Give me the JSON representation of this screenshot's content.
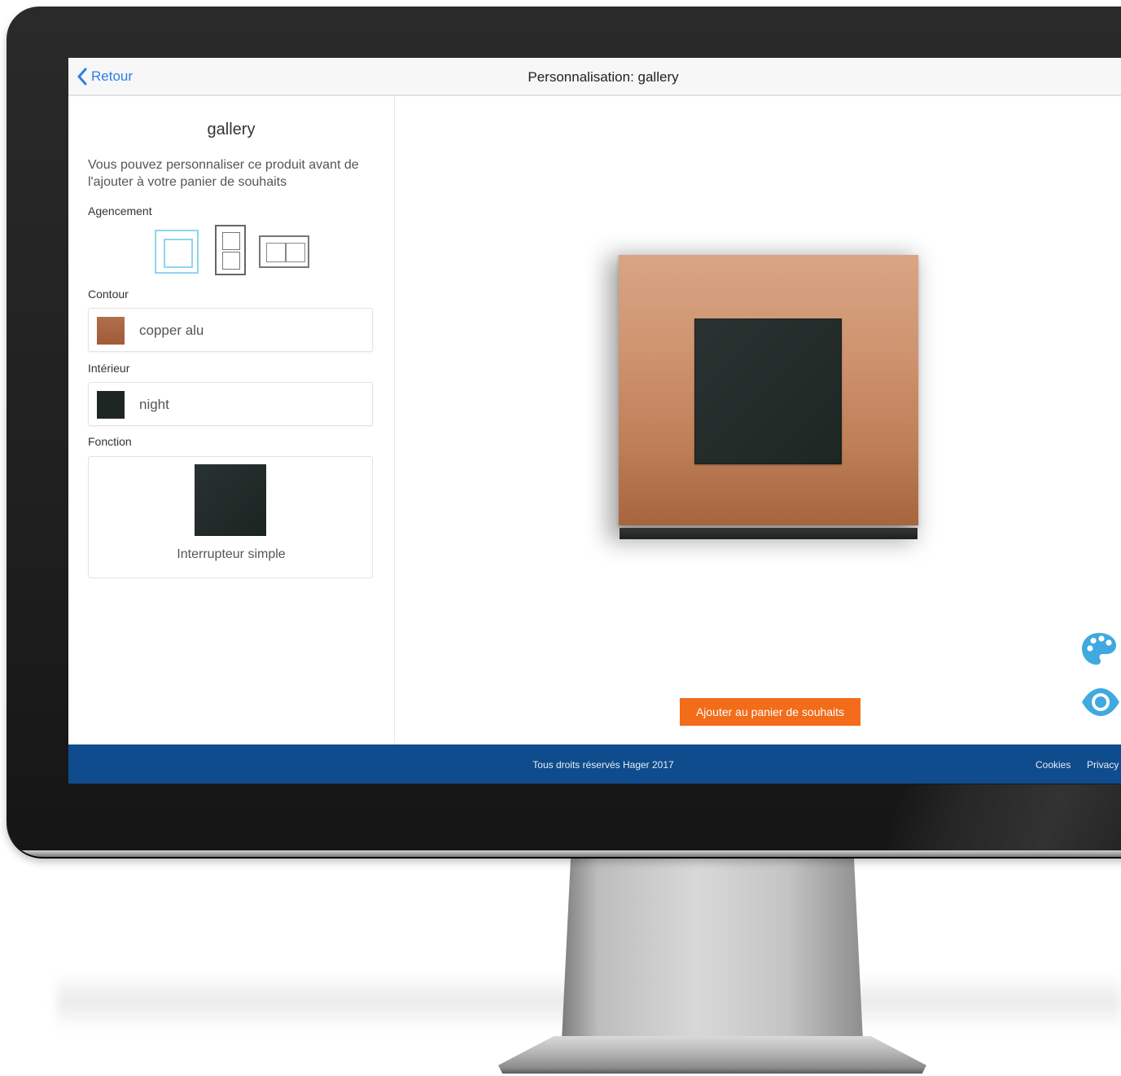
{
  "header": {
    "back_label": "Retour",
    "title": "Personnalisation: gallery"
  },
  "sidebar": {
    "product_name": "gallery",
    "intro": "Vous pouvez personnaliser ce produit avant de l'ajouter à votre panier de souhaits",
    "layout_label": "Agencement",
    "contour_label": "Contour",
    "contour_value": "copper alu",
    "contour_color": "#a7613e",
    "interior_label": "Intérieur",
    "interior_value": "night",
    "interior_color": "#1e2624",
    "function_label": "Fonction",
    "function_value": "Interrupteur simple"
  },
  "preview": {
    "add_button_label": "Ajouter au panier de souhaits",
    "accent_color": "#f26c19",
    "icon_color": "#3fa9e0"
  },
  "footer": {
    "copyright": "Tous droits réservés Hager 2017",
    "cookies_label": "Cookies",
    "privacy_label": "Privacy",
    "background": "#0e4c8d"
  }
}
